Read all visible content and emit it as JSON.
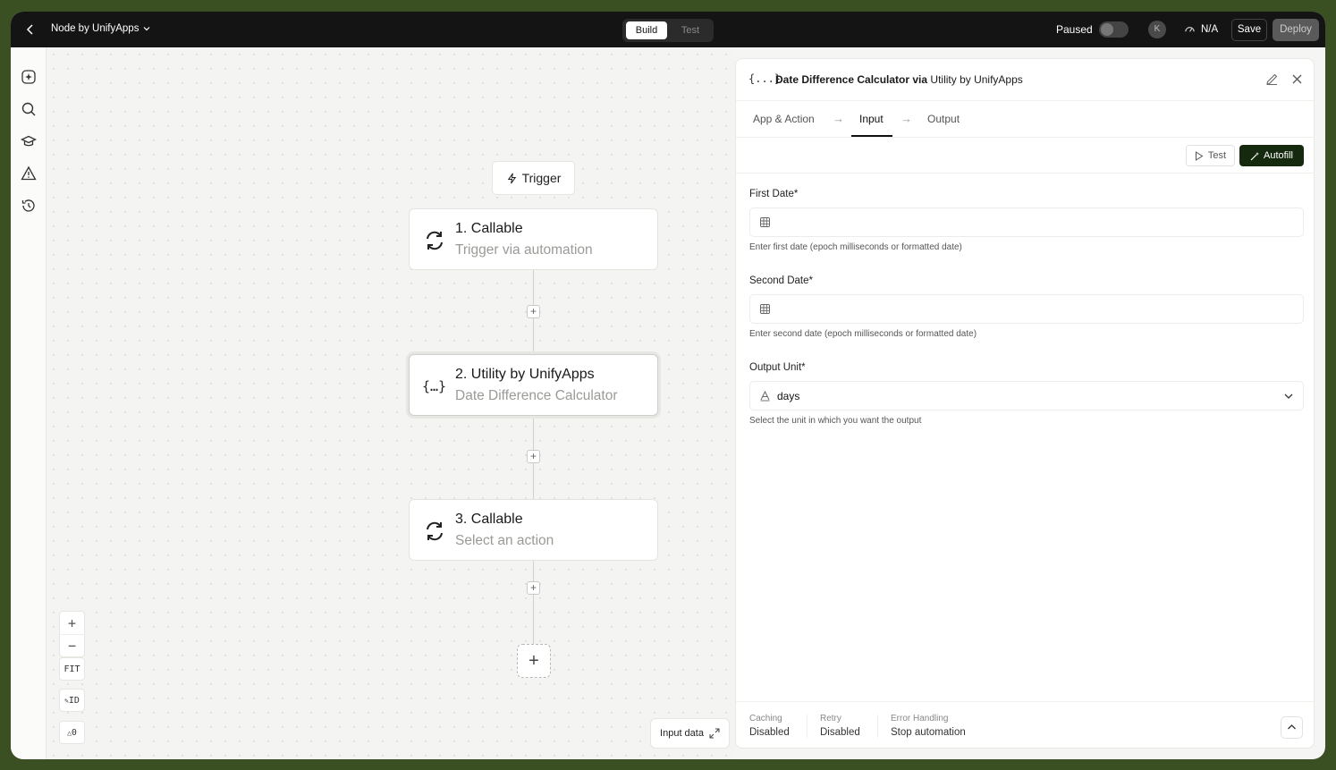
{
  "topbar": {
    "app_name": "Node by UnifyApps",
    "build_label": "Build",
    "test_label": "Test",
    "paused_label": "Paused",
    "avatar_initial": "K",
    "status_label": "N/A",
    "save_label": "Save",
    "deploy_label": "Deploy"
  },
  "canvas": {
    "trigger_label": "Trigger",
    "nodes": [
      {
        "title": "1. Callable",
        "subtitle": "Trigger via automation",
        "icon": "sync-icon"
      },
      {
        "title": "2. Utility by UnifyApps",
        "subtitle": "Date Difference Calculator",
        "icon": "braces-icon"
      },
      {
        "title": "3. Callable",
        "subtitle": "Select an action",
        "icon": "sync-icon"
      }
    ],
    "zoom": {
      "fit_label": "FIT",
      "id_label": "ID",
      "warning_count": "0"
    },
    "input_data_label": "Input data"
  },
  "panel": {
    "icon_text": "{...}",
    "title_main": "Date Difference Calculator via ",
    "title_app": "Utility by UnifyApps",
    "tabs": [
      "App & Action",
      "Input",
      "Output"
    ],
    "active_tab": "Input",
    "test_label": "Test",
    "autofill_label": "Autofill",
    "fields": [
      {
        "label": "First Date*",
        "value": "",
        "help": "Enter first date (epoch milliseconds or formatted date)"
      },
      {
        "label": "Second Date*",
        "value": "",
        "help": "Enter second date (epoch milliseconds or formatted date)"
      },
      {
        "label": "Output Unit*",
        "value": "days",
        "help": "Select the unit in which you want the output"
      }
    ],
    "footer": [
      {
        "key": "Caching",
        "value": "Disabled"
      },
      {
        "key": "Retry",
        "value": "Disabled"
      },
      {
        "key": "Error Handling",
        "value": "Stop automation"
      }
    ]
  },
  "colors": {
    "topbar_bg": "#141414",
    "autofill_bg": "#15290f",
    "frame_outer": "#3a4f22"
  }
}
